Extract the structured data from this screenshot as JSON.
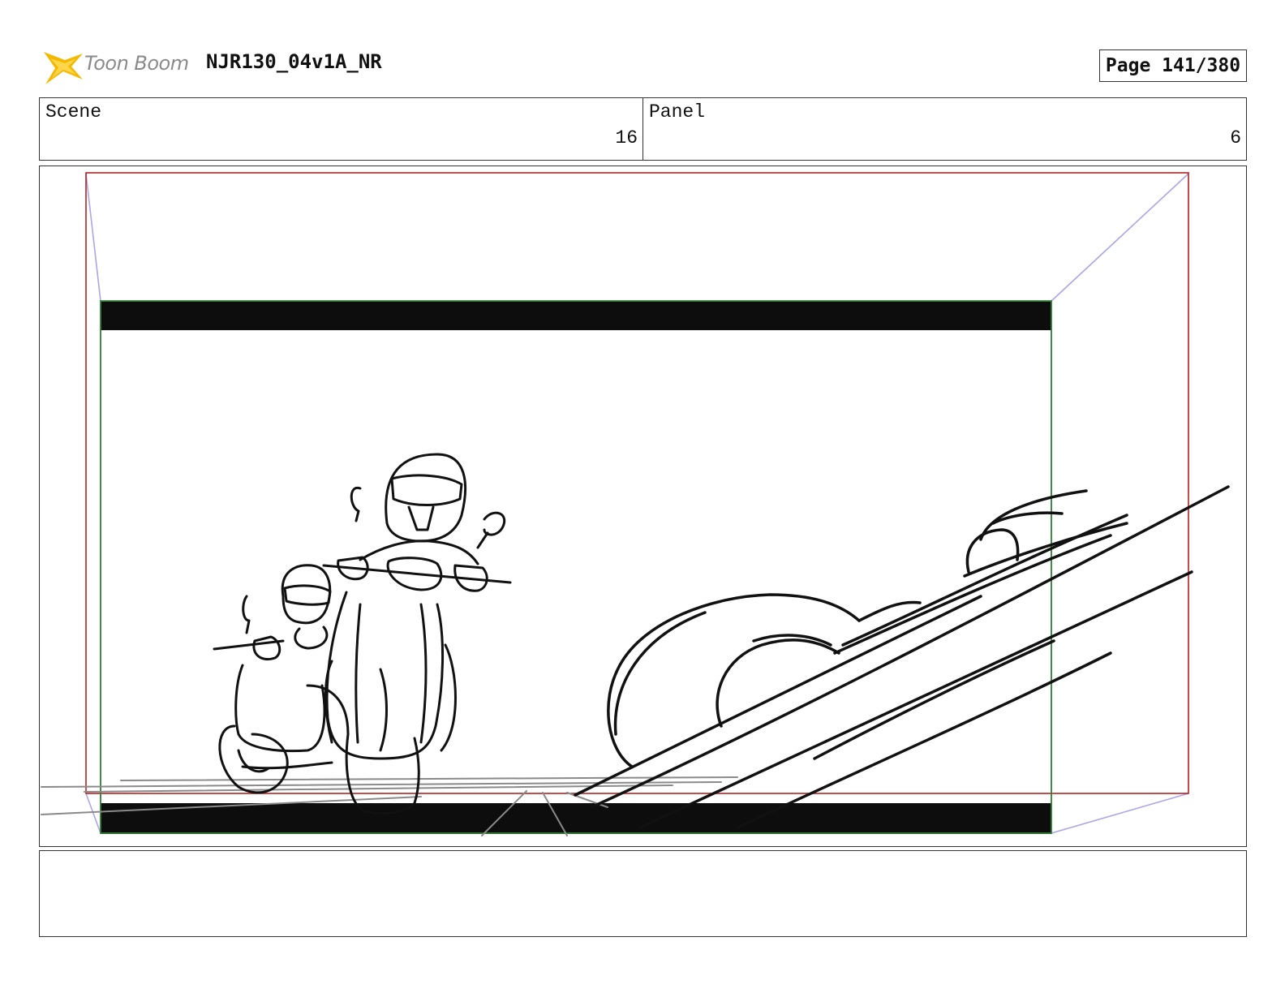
{
  "header": {
    "logo_text": "Toon Boom",
    "project_title": "NJR130_04v1A_NR",
    "page_label": "Page 141/380"
  },
  "info": {
    "scene_label": "Scene",
    "scene_value": "16",
    "panel_label": "Panel",
    "panel_value": "6"
  },
  "notes": {
    "text": ""
  },
  "colors": {
    "camera_frame": "#b22222",
    "safe_frame": "#2e7d32",
    "camera_path": "#aaa6e8",
    "letterbox": "#0d0d0d",
    "logo_star": "#f5b800"
  },
  "icons": {
    "logo": "toon-boom-star-icon"
  }
}
